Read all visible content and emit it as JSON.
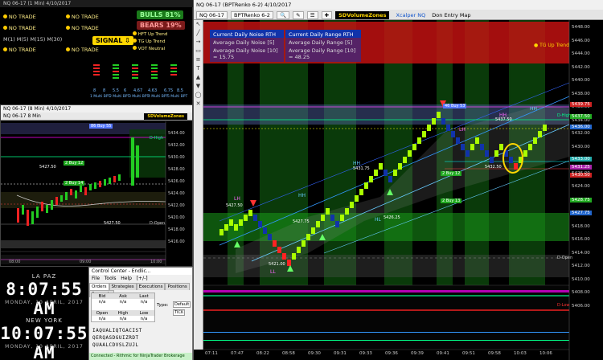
{
  "dashboard": {
    "title": "NQ 06-17 (1 Min)   4/10/2017",
    "rows": [
      {
        "label": "NO TRADE"
      },
      {
        "label": "NO TRADE"
      },
      {
        "label": "NO TRADE"
      }
    ],
    "m_labels": [
      "M(1)",
      "M(5)",
      "M(15)",
      "M(30)"
    ],
    "bulls": "BULLS 81%",
    "bears": "BEARS 19%",
    "signal": "SIGNAL ⇩",
    "signals": [
      "HFT Up Trend",
      "TG Up Trend",
      "VOT Neutral"
    ],
    "bar_values": [
      "8",
      "8",
      "5.5",
      "6",
      "4.67",
      "4.63",
      "6.75",
      "8.5"
    ],
    "bar_labels": [
      "1 Multi BPT",
      "2 Multi BPT",
      "3 Multi BPT",
      "4 Multi BPT",
      "5 Multi BPT"
    ]
  },
  "small_chart": {
    "title": "NQ 06-17 (8 Min)   4/10/2017",
    "toolbar": "NQ 06-17   8 Min",
    "sd_button": "SDVolumeZones",
    "labels": {
      "buy1": "86 Buy 55",
      "dhigh": "D-High",
      "p1": "5427.50",
      "p2": "5427.50",
      "dopen": "D-Open",
      "buy12": "2 Buy 12",
      "buy14": "2 Buy 14"
    },
    "prices": [
      "5434.00",
      "5432.00",
      "5430.00",
      "5428.00",
      "5426.00",
      "5424.00",
      "5422.00",
      "5420.00",
      "5418.00",
      "5416.00"
    ],
    "times": [
      "08:00",
      "09:00",
      "10:00"
    ]
  },
  "clocks": [
    {
      "city": "LA PAZ",
      "time": "8:07:55 AM",
      "date": "MONDAY, 10 APRIL, 2017"
    },
    {
      "city": "NEW YORK",
      "time": "10:07:55 AM",
      "date": "MONDAY, 10 APRIL, 2017"
    }
  ],
  "control_center": {
    "title": "Control Center - Endlic...",
    "menu": [
      "File",
      "Tools",
      "Help",
      "[+/-]"
    ],
    "tabs": [
      "Orders",
      "Strategies",
      "Executions",
      "Positions",
      "Accounts"
    ],
    "headers": [
      "Bid",
      "Ask",
      "Last"
    ],
    "row1": [
      "n/a",
      "n/a",
      "n/a"
    ],
    "headers2": [
      "Open",
      "High",
      "Low"
    ],
    "row2": [
      "n/a",
      "n/a",
      "n/a"
    ],
    "type_label": "Type:",
    "type_value": "Default",
    "tick_value": "TICK",
    "keys1": "IAQUALIQTGACIST",
    "keys2": "QERQASDGUIZRDT",
    "keys3": "QUAALCDVSLZUJL",
    "status": "Connected - Rithmic for NinjaTrader Brokerage"
  },
  "main_chart": {
    "title": "NQ 06-17 (BPTRenko 6-2)   4/10/2017",
    "toolbar": {
      "instrument": "NQ 06-17",
      "bartype": "BPTRenko 6-2",
      "sd_button": "SDVolumeZones",
      "xcalper": "Xcalper NQ",
      "map": "Don Entry Map"
    },
    "info": {
      "noise_rth": "Current Daily Noise RTH = 5.75",
      "range_rth": "Current Daily Range RTH = 23.00",
      "avg_noise5": "Average Daily Noise [5] = 20.50",
      "avg_range5": "Average Daily Range [5] = 53.00",
      "avg_noise10": "Average Daily Noise [10] = 15.75",
      "avg_range10": "Average Daily Range [10] = 48.25"
    },
    "tg_up": "TG Up Trend",
    "annotations": {
      "buy53": "46 Buy 53",
      "p5437": "5437.50",
      "p5432": "5432.50",
      "p5431": "5431.75",
      "p5427": "5427.75",
      "p5426": "5426.25",
      "p5421": "5421.00",
      "p5427b": "5427.50",
      "p5428": "5428.75",
      "hh": "HH",
      "lh": "LH",
      "hl": "HL",
      "ll": "LL",
      "dhigh": "D-High",
      "dopen": "D-Open",
      "dlow": "D-Low",
      "buy1": "2  Buy 12",
      "buy2": "2  Buy 13"
    },
    "price_axis": [
      "5448.00",
      "5446.00",
      "5444.00",
      "5442.00",
      "5440.00",
      "5438.00",
      "5436.00",
      "5434.00",
      "5432.00",
      "5430.00",
      "5428.00",
      "5426.00",
      "5424.00",
      "5422.00",
      "5420.00",
      "5418.00",
      "5416.00",
      "5414.00",
      "5412.00",
      "5410.00",
      "5408.00",
      "5406.00"
    ],
    "time_axis": [
      "07:11",
      "07:47",
      "08:22",
      "08:58",
      "09:30",
      "09:31",
      "09:33",
      "09:36",
      "09:39",
      "09:41",
      "09:51",
      "09:58",
      "10:03",
      "10:06"
    ],
    "price_tags": [
      "5439.75",
      "5437.50",
      "5436.00",
      "5433.00",
      "5431.25",
      "5430.50",
      "5428.75",
      "5427.75"
    ]
  },
  "colors": {
    "bull_green": "#22cc22",
    "bear_red": "#dd1111",
    "signal_yellow": "#ffd700",
    "renko_lime": "#aaff00"
  }
}
